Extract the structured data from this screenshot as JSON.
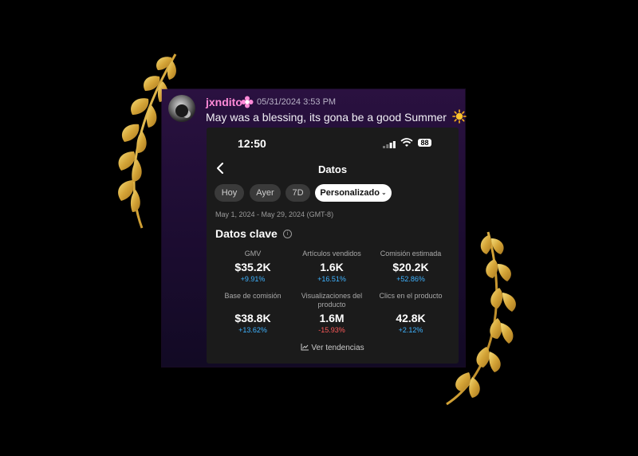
{
  "post": {
    "username": "jxndito",
    "timestamp": "05/31/2024 3:53 PM",
    "message": "May was a blessing, its gona be a good Summer"
  },
  "phone": {
    "time": "12:50",
    "battery": "88",
    "header_title": "Datos",
    "chips": [
      {
        "label": "Hoy"
      },
      {
        "label": "Ayer"
      },
      {
        "label": "7D"
      },
      {
        "label": "Personalizado",
        "selected": true
      }
    ],
    "date_range": "May 1, 2024 - May 29, 2024 (GMT-8)",
    "section_title": "Datos clave",
    "metrics": [
      {
        "label": "GMV",
        "value": "$35.2K",
        "delta": "+9.91%"
      },
      {
        "label": "Artículos vendidos",
        "value": "1.6K",
        "delta": "+16.51%"
      },
      {
        "label": "Comisión estimada",
        "value": "$20.2K",
        "delta": "+52.86%"
      },
      {
        "label": "Base de comisión",
        "value": "$38.8K",
        "delta": "+13.62%"
      },
      {
        "label": "Visualizaciones del producto",
        "value": "1.6M",
        "delta": "-15.93%"
      },
      {
        "label": "Clics en el producto",
        "value": "42.8K",
        "delta": "+2.12%"
      }
    ],
    "trends_link": "Ver tendencias"
  },
  "colors": {
    "username": "#ff8ad8",
    "positive": "#3fb3ff",
    "negative": "#ff5a5a",
    "laurel": "#d9b24a"
  }
}
